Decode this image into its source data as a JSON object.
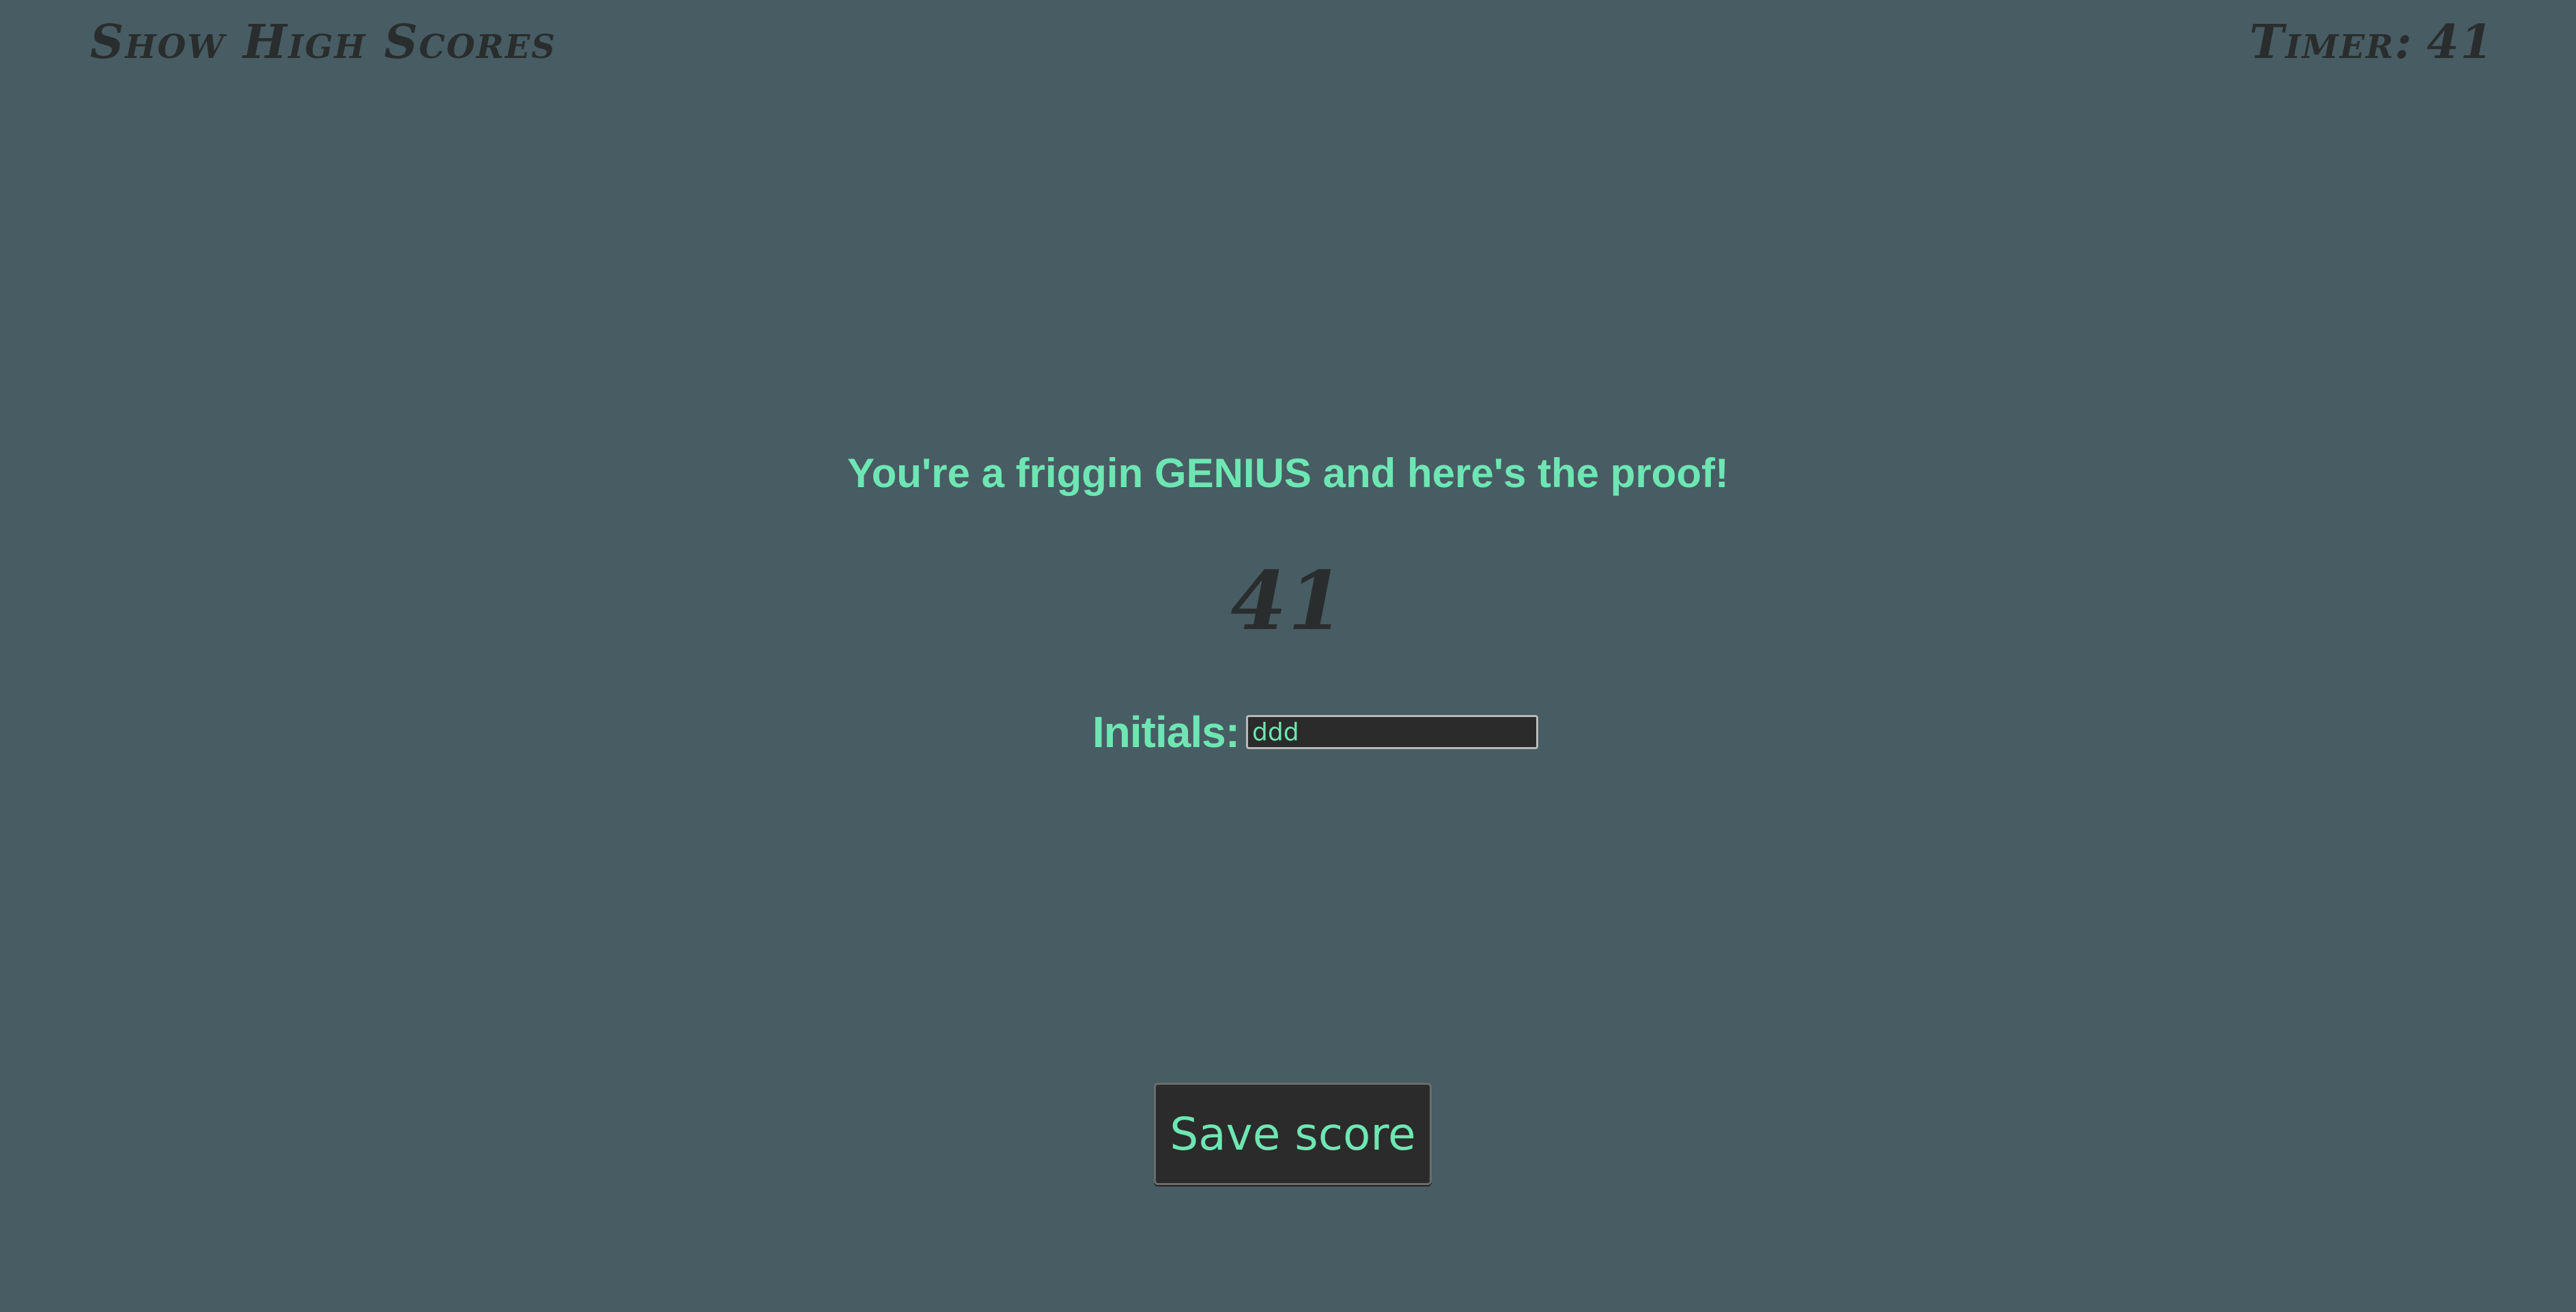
{
  "header": {
    "high_scores_link": "Show High Scores",
    "timer_label": "Timer:",
    "timer_value": "41"
  },
  "result": {
    "headline": "You're a friggin GENIUS and here's the proof!",
    "score": "41"
  },
  "form": {
    "initials_label": "Initials:",
    "initials_value": "ddd",
    "save_button_label": "Save score"
  },
  "colors": {
    "background": "#475c63",
    "accent": "#6ee6b3",
    "dark_text": "#2a2d2d",
    "button_bg": "#2a2b2a"
  }
}
